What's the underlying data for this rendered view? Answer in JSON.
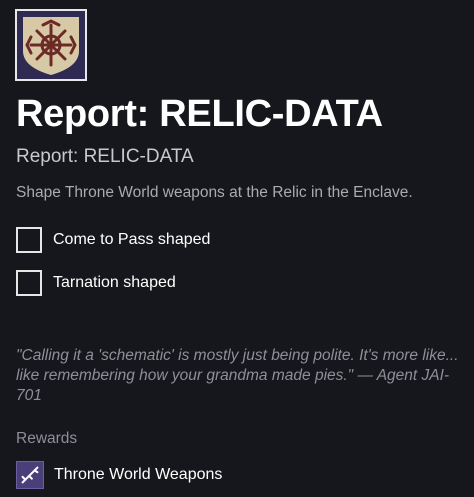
{
  "quest": {
    "emblem_icon": "relic-schematic-icon",
    "title": "Report: RELIC-DATA",
    "subtitle": "Report: RELIC-DATA",
    "description": "Shape Throne World weapons at the Relic in the Enclave.",
    "objectives": [
      {
        "label": "Come to Pass shaped",
        "completed": false
      },
      {
        "label": "Tarnation shaped",
        "completed": false
      }
    ],
    "quote": "\"Calling it a 'schematic' is mostly just being polite. It's more like... like remembering how your grandma made pies.\" — Agent JAI-701",
    "rewards_heading": "Rewards",
    "rewards": [
      {
        "icon": "weapon-icon",
        "label": "Throne World Weapons"
      }
    ]
  },
  "colors": {
    "background": "#16171c",
    "emblem_background": "#2e2a52",
    "emblem_plate": "#d8c9a6",
    "emblem_mark": "#6b2a25",
    "reward_icon_background": "#4b3f7a"
  }
}
